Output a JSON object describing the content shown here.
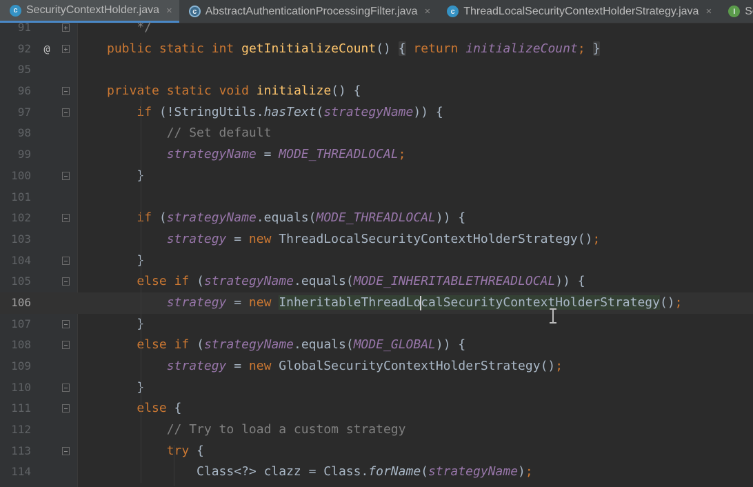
{
  "tabs": [
    {
      "label": "SecurityContextHolder.java",
      "icon": "class-icon",
      "active": true
    },
    {
      "label": "AbstractAuthenticationProcessingFilter.java",
      "icon": "abstract-class-icon",
      "active": false
    },
    {
      "label": "ThreadLocalSecurityContextHolderStrategy.java",
      "icon": "class-icon",
      "active": false
    },
    {
      "label": "Se",
      "icon": "interface-icon",
      "active": false
    }
  ],
  "tab_icon_letters": {
    "class": "c",
    "interface": "I"
  },
  "tab_close_glyph": "×",
  "gutter": {
    "override_marker": "@"
  },
  "lines": [
    {
      "n": "91",
      "code": "    */"
    },
    {
      "n": "92",
      "code": "public static int getInitializeCount() { return initializeCount; }"
    },
    {
      "n": "95",
      "code": ""
    },
    {
      "n": "96",
      "code": "private static void initialize() {"
    },
    {
      "n": "97",
      "code": "    if (!StringUtils.hasText(strategyName)) {"
    },
    {
      "n": "98",
      "code": "        // Set default"
    },
    {
      "n": "99",
      "code": "        strategyName = MODE_THREADLOCAL;"
    },
    {
      "n": "100",
      "code": "    }"
    },
    {
      "n": "101",
      "code": ""
    },
    {
      "n": "102",
      "code": "    if (strategyName.equals(MODE_THREADLOCAL)) {"
    },
    {
      "n": "103",
      "code": "        strategy = new ThreadLocalSecurityContextHolderStrategy();"
    },
    {
      "n": "104",
      "code": "    }"
    },
    {
      "n": "105",
      "code": "    else if (strategyName.equals(MODE_INHERITABLETHREADLOCAL)) {"
    },
    {
      "n": "106",
      "code": "        strategy = new InheritableThreadLocalSecurityContextHolderStrategy();"
    },
    {
      "n": "107",
      "code": "    }"
    },
    {
      "n": "108",
      "code": "    else if (strategyName.equals(MODE_GLOBAL)) {"
    },
    {
      "n": "109",
      "code": "        strategy = new GlobalSecurityContextHolderStrategy();"
    },
    {
      "n": "110",
      "code": "    }"
    },
    {
      "n": "111",
      "code": "    else {"
    },
    {
      "n": "112",
      "code": "        // Try to load a custom strategy"
    },
    {
      "n": "113",
      "code": "        try {"
    },
    {
      "n": "114",
      "code": "            Class<?> clazz = Class.forName(strategyName);"
    }
  ],
  "current_line": "106",
  "colors": {
    "background": "#2b2b2b",
    "gutter": "#313335",
    "keyword": "#cc7832",
    "method": "#ffc66d",
    "field": "#9876aa",
    "comment": "#808080",
    "text": "#a9b7c6",
    "active_tab_underline": "#4a88c7"
  }
}
